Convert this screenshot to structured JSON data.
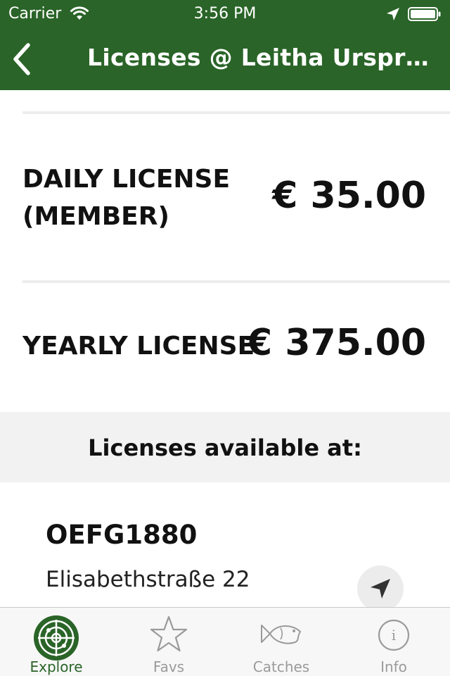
{
  "status_bar": {
    "carrier": "Carrier",
    "time": "3:56 PM",
    "wifi_icon": "wifi-icon",
    "location_icon": "location-arrow-icon",
    "battery_icon": "battery-full-icon"
  },
  "nav": {
    "title": "Licenses @ Leitha Ursprung…",
    "back_icon": "chevron-left-icon",
    "bar_color": "#2a6428"
  },
  "licenses": [
    {
      "name_line1": "DAILY LICENSE",
      "name_line2": "(MEMBER)",
      "price": "€ 35.00"
    },
    {
      "name_line1": "YEARLY LICENSE",
      "price": "€ 375.00"
    }
  ],
  "section": {
    "title": "Licenses available at:"
  },
  "shop": {
    "name": "OEFG1880",
    "street": "Elisabethstraße 22",
    "navigate_icon": "navigation-arrow-icon"
  },
  "tabbar": {
    "active_color": "#2a6428",
    "inactive_color": "#9a9a9a",
    "tabs": [
      {
        "label": "Explore",
        "icon": "radar-icon",
        "active": true
      },
      {
        "label": "Favs",
        "icon": "star-icon",
        "active": false
      },
      {
        "label": "Catches",
        "icon": "fish-icon",
        "active": false
      },
      {
        "label": "Info",
        "icon": "info-icon",
        "active": false
      }
    ]
  }
}
